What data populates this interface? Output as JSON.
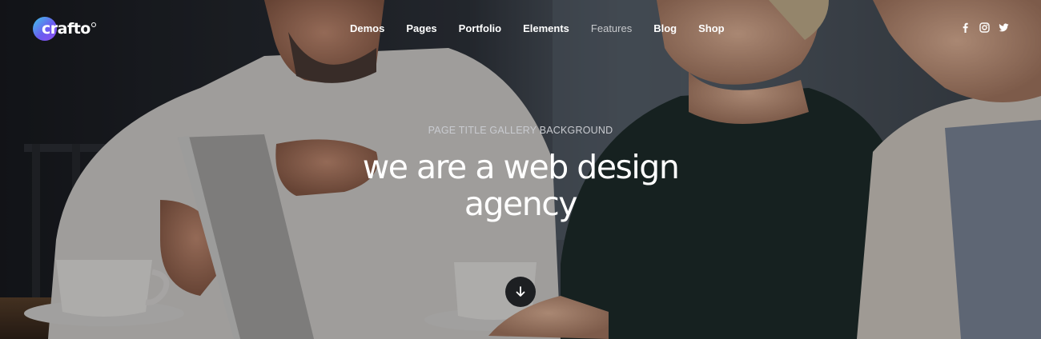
{
  "brand": {
    "name": "crafto"
  },
  "nav": [
    {
      "label": "Demos"
    },
    {
      "label": "Pages"
    },
    {
      "label": "Portfolio"
    },
    {
      "label": "Elements"
    },
    {
      "label": "Features"
    },
    {
      "label": "Blog"
    },
    {
      "label": "Shop"
    }
  ],
  "active_nav": "Features",
  "social": [
    "facebook-icon",
    "instagram-icon",
    "twitter-icon"
  ],
  "hero": {
    "subtitle": "PAGE TITLE GALLERY BACKGROUND",
    "title_line1": "we are a web design",
    "title_line2": "agency"
  },
  "colors": {
    "accent_gradient_start": "#3ec6e8",
    "accent_gradient_end": "#8f4df0",
    "text": "#ffffff"
  }
}
